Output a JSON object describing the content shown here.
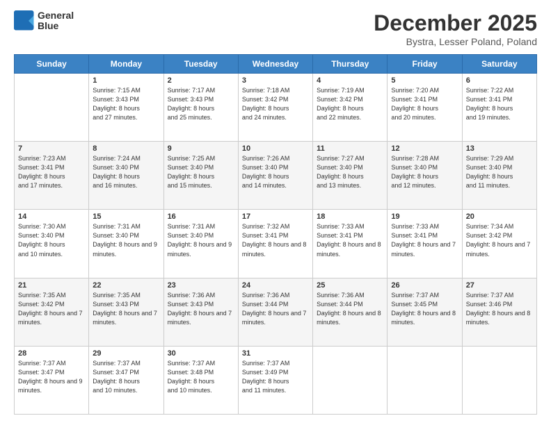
{
  "header": {
    "logo": {
      "line1": "General",
      "line2": "Blue"
    },
    "month": "December 2025",
    "location": "Bystra, Lesser Poland, Poland"
  },
  "weekdays": [
    "Sunday",
    "Monday",
    "Tuesday",
    "Wednesday",
    "Thursday",
    "Friday",
    "Saturday"
  ],
  "weeks": [
    [
      {
        "day": null,
        "sunrise": null,
        "sunset": null,
        "daylight": null
      },
      {
        "day": "1",
        "sunrise": "7:15 AM",
        "sunset": "3:43 PM",
        "daylight": "8 hours and 27 minutes."
      },
      {
        "day": "2",
        "sunrise": "7:17 AM",
        "sunset": "3:43 PM",
        "daylight": "8 hours and 25 minutes."
      },
      {
        "day": "3",
        "sunrise": "7:18 AM",
        "sunset": "3:42 PM",
        "daylight": "8 hours and 24 minutes."
      },
      {
        "day": "4",
        "sunrise": "7:19 AM",
        "sunset": "3:42 PM",
        "daylight": "8 hours and 22 minutes."
      },
      {
        "day": "5",
        "sunrise": "7:20 AM",
        "sunset": "3:41 PM",
        "daylight": "8 hours and 20 minutes."
      },
      {
        "day": "6",
        "sunrise": "7:22 AM",
        "sunset": "3:41 PM",
        "daylight": "8 hours and 19 minutes."
      }
    ],
    [
      {
        "day": "7",
        "sunrise": "7:23 AM",
        "sunset": "3:41 PM",
        "daylight": "8 hours and 17 minutes."
      },
      {
        "day": "8",
        "sunrise": "7:24 AM",
        "sunset": "3:40 PM",
        "daylight": "8 hours and 16 minutes."
      },
      {
        "day": "9",
        "sunrise": "7:25 AM",
        "sunset": "3:40 PM",
        "daylight": "8 hours and 15 minutes."
      },
      {
        "day": "10",
        "sunrise": "7:26 AM",
        "sunset": "3:40 PM",
        "daylight": "8 hours and 14 minutes."
      },
      {
        "day": "11",
        "sunrise": "7:27 AM",
        "sunset": "3:40 PM",
        "daylight": "8 hours and 13 minutes."
      },
      {
        "day": "12",
        "sunrise": "7:28 AM",
        "sunset": "3:40 PM",
        "daylight": "8 hours and 12 minutes."
      },
      {
        "day": "13",
        "sunrise": "7:29 AM",
        "sunset": "3:40 PM",
        "daylight": "8 hours and 11 minutes."
      }
    ],
    [
      {
        "day": "14",
        "sunrise": "7:30 AM",
        "sunset": "3:40 PM",
        "daylight": "8 hours and 10 minutes."
      },
      {
        "day": "15",
        "sunrise": "7:31 AM",
        "sunset": "3:40 PM",
        "daylight": "8 hours and 9 minutes."
      },
      {
        "day": "16",
        "sunrise": "7:31 AM",
        "sunset": "3:40 PM",
        "daylight": "8 hours and 9 minutes."
      },
      {
        "day": "17",
        "sunrise": "7:32 AM",
        "sunset": "3:41 PM",
        "daylight": "8 hours and 8 minutes."
      },
      {
        "day": "18",
        "sunrise": "7:33 AM",
        "sunset": "3:41 PM",
        "daylight": "8 hours and 8 minutes."
      },
      {
        "day": "19",
        "sunrise": "7:33 AM",
        "sunset": "3:41 PM",
        "daylight": "8 hours and 7 minutes."
      },
      {
        "day": "20",
        "sunrise": "7:34 AM",
        "sunset": "3:42 PM",
        "daylight": "8 hours and 7 minutes."
      }
    ],
    [
      {
        "day": "21",
        "sunrise": "7:35 AM",
        "sunset": "3:42 PM",
        "daylight": "8 hours and 7 minutes."
      },
      {
        "day": "22",
        "sunrise": "7:35 AM",
        "sunset": "3:43 PM",
        "daylight": "8 hours and 7 minutes."
      },
      {
        "day": "23",
        "sunrise": "7:36 AM",
        "sunset": "3:43 PM",
        "daylight": "8 hours and 7 minutes."
      },
      {
        "day": "24",
        "sunrise": "7:36 AM",
        "sunset": "3:44 PM",
        "daylight": "8 hours and 7 minutes."
      },
      {
        "day": "25",
        "sunrise": "7:36 AM",
        "sunset": "3:44 PM",
        "daylight": "8 hours and 8 minutes."
      },
      {
        "day": "26",
        "sunrise": "7:37 AM",
        "sunset": "3:45 PM",
        "daylight": "8 hours and 8 minutes."
      },
      {
        "day": "27",
        "sunrise": "7:37 AM",
        "sunset": "3:46 PM",
        "daylight": "8 hours and 8 minutes."
      }
    ],
    [
      {
        "day": "28",
        "sunrise": "7:37 AM",
        "sunset": "3:47 PM",
        "daylight": "8 hours and 9 minutes."
      },
      {
        "day": "29",
        "sunrise": "7:37 AM",
        "sunset": "3:47 PM",
        "daylight": "8 hours and 10 minutes."
      },
      {
        "day": "30",
        "sunrise": "7:37 AM",
        "sunset": "3:48 PM",
        "daylight": "8 hours and 10 minutes."
      },
      {
        "day": "31",
        "sunrise": "7:37 AM",
        "sunset": "3:49 PM",
        "daylight": "8 hours and 11 minutes."
      },
      {
        "day": null,
        "sunrise": null,
        "sunset": null,
        "daylight": null
      },
      {
        "day": null,
        "sunrise": null,
        "sunset": null,
        "daylight": null
      },
      {
        "day": null,
        "sunrise": null,
        "sunset": null,
        "daylight": null
      }
    ]
  ]
}
